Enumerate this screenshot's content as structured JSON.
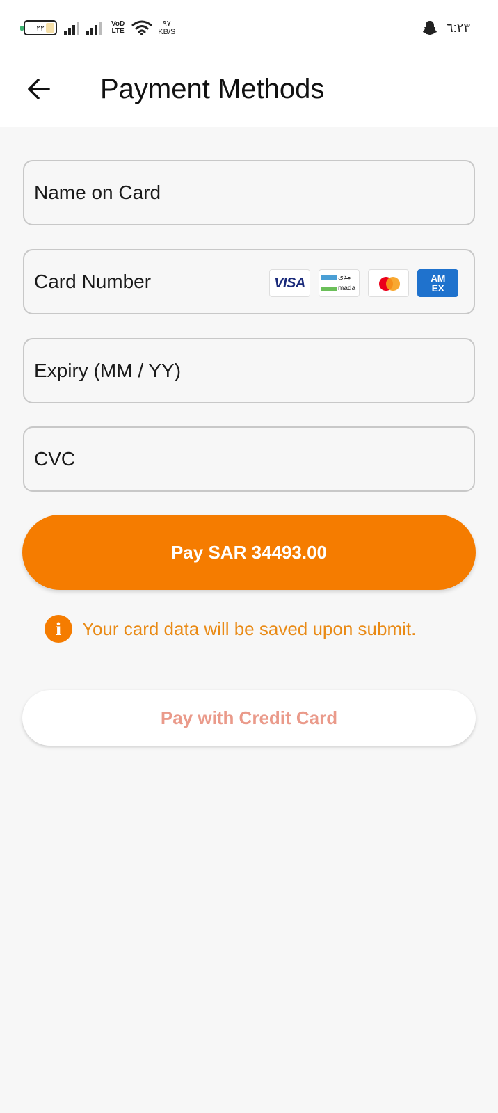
{
  "status_bar": {
    "battery_level": "٢٢",
    "network_label_top": "VoD",
    "network_label_bottom": "LTE",
    "speed_value": "٩٧",
    "speed_unit": "KB/S",
    "time": "٦:٢٣",
    "icons": [
      "battery-icon",
      "signal-icon",
      "signal-icon",
      "volte-icon",
      "wifi-icon",
      "snapchat-icon"
    ]
  },
  "header": {
    "title": "Payment Methods",
    "back_icon": "arrow-left-icon"
  },
  "form": {
    "name_placeholder": "Name on Card",
    "card_number_placeholder": "Card Number",
    "expiry_placeholder": "Expiry (MM / YY)",
    "cvc_placeholder": "CVC",
    "card_brands": {
      "visa": "VISA",
      "mada_arabic": "مدى",
      "mada": "mada",
      "amex_top": "AM",
      "amex_bottom": "EX"
    }
  },
  "pay_button_label": "Pay SAR 34493.00",
  "notice": {
    "icon": "info-icon",
    "text": "Your card data will be saved upon submit."
  },
  "credit_card_button_label": "Pay with Credit Card",
  "colors": {
    "accent": "#f57c00",
    "notice_text": "#e98a15",
    "secondary_button_text": "#ea9a8a",
    "background": "#f7f7f7"
  }
}
